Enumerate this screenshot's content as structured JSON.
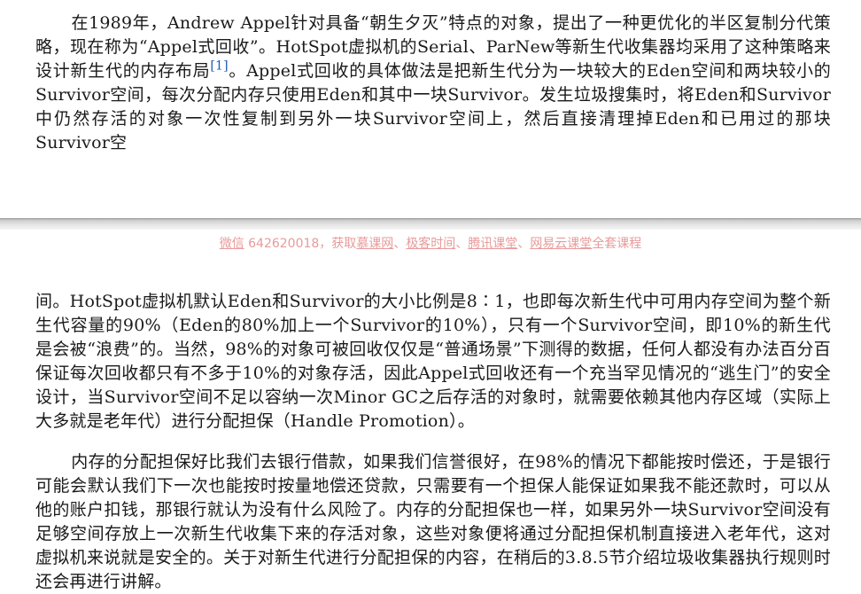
{
  "page1": {
    "para1_a": "在1989年，Andrew Appel针对具备“朝生夕灭”特点的对象，提出了一种更优化的半区复制分代策略，现在称为“Appel式回收”。HotSpot虚拟机的Serial、ParNew等新生代收集器均采用了这种策略来设计新生代的内存布局",
    "para1_ref": "[1]",
    "para1_b": "。Appel式回收的具体做法是把新生代分为一块较大的Eden空间和两块较小的Survivor空间，每次分配内存只使用Eden和其中一块Survivor。发生垃圾搜集时，将Eden和Survivor中仍然存活的对象一次性复制到另外一块Survivor空间上，然后直接清理掉Eden和已用过的那块Survivor空"
  },
  "watermark": {
    "wechat": "微信",
    "text1": " 642620018，获取",
    "link1": "慕课网",
    "sep1": "、",
    "link2": "极客时间",
    "sep2": "、",
    "link3": "腾讯课堂",
    "sep3": "、",
    "link4": "网易云课堂",
    "text2": "全套课程"
  },
  "page2": {
    "para2": "间。HotSpot虚拟机默认Eden和Survivor的大小比例是8∶1，也即每次新生代中可用内存空间为整个新生代容量的90%（Eden的80%加上一个Survivor的10%），只有一个Survivor空间，即10%的新生代是会被“浪费”的。当然，98%的对象可被回收仅仅是“普通场景”下测得的数据，任何人都没有办法百分百保证每次回收都只有不多于10%的对象存活，因此Appel式回收还有一个充当罕见情况的“逃生门”的安全设计，当Survivor空间不足以容纳一次Minor GC之后存活的对象时，就需要依赖其他内存区域（实际上大多就是老年代）进行分配担保（Handle Promotion）。",
    "para3": "内存的分配担保好比我们去银行借款，如果我们信誉很好，在98%的情况下都能按时偿还，于是银行可能会默认我们下一次也能按时按量地偿还贷款，只需要有一个担保人能保证如果我不能还款时，可以从他的账户扣钱，那银行就认为没有什么风险了。内存的分配担保也一样，如果另外一块Survivor空间没有足够空间存放上一次新生代收集下来的存活对象，这些对象便将通过分配担保机制直接进入老年代，这对虚拟机来说就是安全的。关于对新生代进行分配担保的内容，在稍后的3.8.5节介绍垃圾收集器执行规则时还会再进行讲解。"
  }
}
